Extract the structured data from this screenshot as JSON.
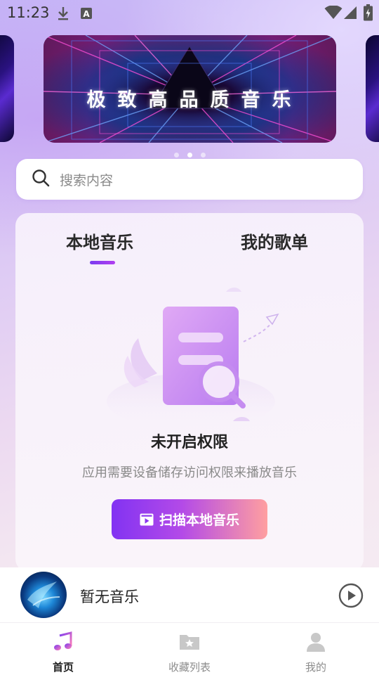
{
  "status_bar": {
    "time": "11:23",
    "icons": [
      "download-icon",
      "a-notification-icon",
      "wifi-icon",
      "signal-icon",
      "battery-charging-icon"
    ]
  },
  "banner": {
    "title": "极致高品质音乐",
    "dots": [
      false,
      true,
      false
    ]
  },
  "search": {
    "placeholder": "搜索内容",
    "icon": "search-icon"
  },
  "tabs": [
    {
      "label": "本地音乐",
      "active": true
    },
    {
      "label": "我的歌单",
      "active": false
    }
  ],
  "empty_state": {
    "title": "未开启权限",
    "description": "应用需要设备储存访问权限来播放音乐",
    "button_label": "扫描本地音乐",
    "button_icon": "scan-video-icon"
  },
  "player": {
    "title": "暂无音乐",
    "play_icon": "play-circle-icon"
  },
  "nav": [
    {
      "label": "首页",
      "icon": "music-note-icon",
      "active": true
    },
    {
      "label": "收藏列表",
      "icon": "folder-star-icon",
      "active": false
    },
    {
      "label": "我的",
      "icon": "user-icon",
      "active": false
    }
  ],
  "colors": {
    "accent_start": "#8233f2",
    "accent_end": "#ff9fa0",
    "tab_underline": "#7a3cf0"
  }
}
